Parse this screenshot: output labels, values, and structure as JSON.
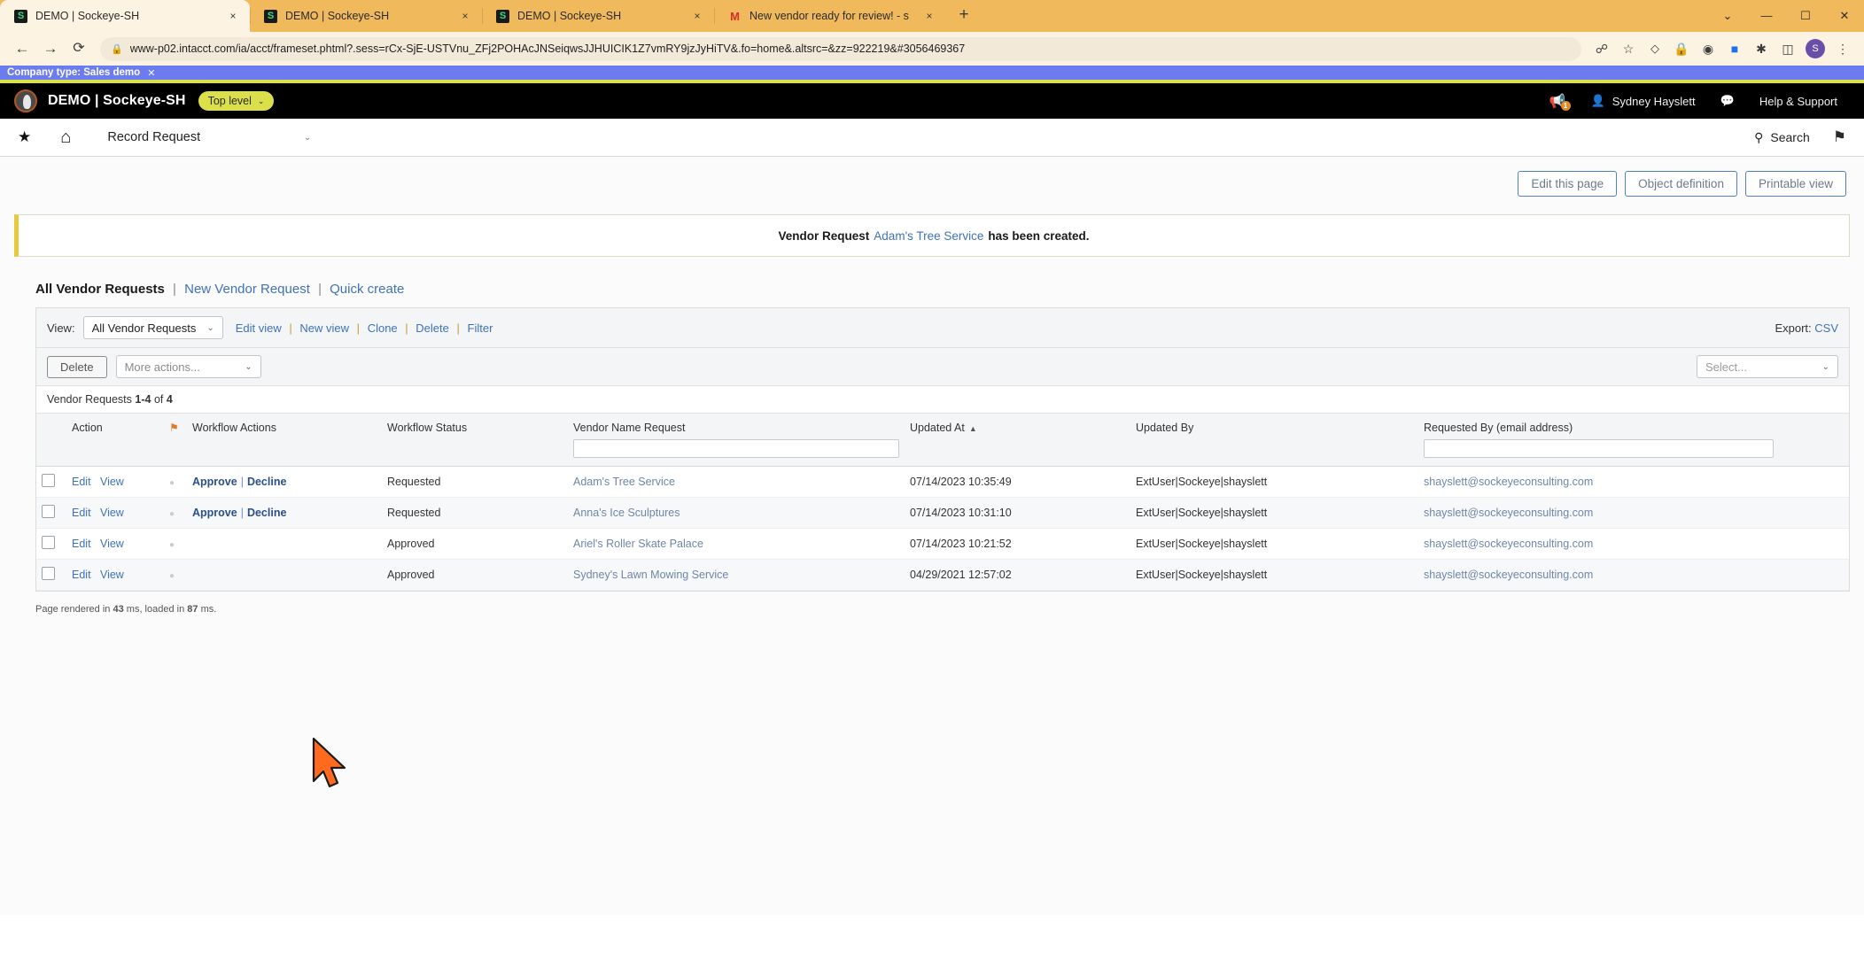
{
  "browser": {
    "tabs": [
      {
        "title": "DEMO | Sockeye-SH",
        "favicon": "S",
        "active": true
      },
      {
        "title": "DEMO | Sockeye-SH",
        "favicon": "S",
        "active": false
      },
      {
        "title": "DEMO | Sockeye-SH",
        "favicon": "S",
        "active": false
      },
      {
        "title": "New vendor ready for review! - s",
        "favicon": "M",
        "active": false
      }
    ],
    "new_tab_label": "+",
    "close_label": "×",
    "window_controls": [
      "⌄",
      "—",
      "☐",
      "✕"
    ],
    "back_label": "←",
    "forward_label": "→",
    "reload_label": "⟳",
    "lock_icon": "🔒",
    "url": "www-p02.intacct.com/ia/acct/frameset.phtml?.sess=rCx-SjE-USTVnu_ZFj2POHAcJNSeiqwsJJHUICIK1Z7vmRY9jzJyHiTV&.fo=home&.altsrc=&zz=922219&#3056469367",
    "toolbar_icons": [
      "share-icon",
      "star-icon",
      "puzzle-icon",
      "shield-icon",
      "cast-icon",
      "extension-icon",
      "window-icon",
      "account-icon",
      "menu-icon"
    ],
    "profile_initial": "S"
  },
  "demo_banner": {
    "text": "Company type: Sales demo",
    "close": "✕"
  },
  "app_header": {
    "title": "DEMO | Sockeye-SH",
    "entity_pill": "Top level",
    "chevron": "⌄",
    "user": "Sydney Hayslett",
    "help": "Help & Support",
    "megaphone_badge": "1"
  },
  "nav": {
    "star": "★",
    "home": "⌂",
    "module": "Record Request",
    "module_chevron": "⌄",
    "search": "Search",
    "search_icon": "⚲",
    "bookmark": "⚑"
  },
  "top_buttons": {
    "edit_this_page": "Edit this page",
    "object_definition": "Object definition",
    "printable_view": "Printable view"
  },
  "alert": {
    "prefix": "Vendor Request",
    "link": "Adam's Tree Service",
    "suffix": "has been created."
  },
  "list_header": {
    "title": "All Vendor Requests",
    "new_request": "New Vendor Request",
    "quick_create": "Quick create",
    "separator": "|"
  },
  "toolbar": {
    "view_label": "View:",
    "view_value": "All Vendor Requests",
    "view_chevron": "⌄",
    "links": [
      "Edit view",
      "New view",
      "Clone",
      "Delete",
      "Filter"
    ],
    "link_separator": "|",
    "export_label": "Export:",
    "export_value": "CSV"
  },
  "actions": {
    "delete": "Delete",
    "more_actions": "More actions...",
    "more_chevron": "⌄",
    "select": "Select...",
    "select_chevron": "⌄"
  },
  "count": {
    "prefix": "Vendor Requests",
    "range": "1-4",
    "of": "of",
    "total": "4"
  },
  "table": {
    "columns": [
      {
        "label": "Action",
        "filter": false
      },
      {
        "label": "",
        "icon": "flag-icon",
        "filter": false
      },
      {
        "label": "Workflow Actions",
        "filter": false
      },
      {
        "label": "Workflow Status",
        "filter": false
      },
      {
        "label": "Vendor Name Request",
        "filter": true
      },
      {
        "label": "Updated At",
        "sort": "▲",
        "filter": false
      },
      {
        "label": "Updated By",
        "filter": false
      },
      {
        "label": "Requested By (email address)",
        "filter": true
      }
    ],
    "row_actions": {
      "edit": "Edit",
      "view": "View"
    },
    "rows": [
      {
        "approve": "Approve",
        "decline": "Decline",
        "status": "Requested",
        "vendor": "Adam's Tree Service",
        "updated_at": "07/14/2023 10:35:49",
        "updated_by": "ExtUser|Sockeye|shayslett",
        "requested_by": "shayslett@sockeyeconsulting.com"
      },
      {
        "approve": "Approve",
        "decline": "Decline",
        "status": "Requested",
        "vendor": "Anna's Ice Sculptures",
        "updated_at": "07/14/2023 10:31:10",
        "updated_by": "ExtUser|Sockeye|shayslett",
        "requested_by": "shayslett@sockeyeconsulting.com"
      },
      {
        "approve": "",
        "decline": "",
        "status": "Approved",
        "vendor": "Ariel's Roller Skate Palace",
        "updated_at": "07/14/2023 10:21:52",
        "updated_by": "ExtUser|Sockeye|shayslett",
        "requested_by": "shayslett@sockeyeconsulting.com"
      },
      {
        "approve": "",
        "decline": "",
        "status": "Approved",
        "vendor": "Sydney's Lawn Mowing Service",
        "updated_at": "04/29/2021 12:57:02",
        "updated_by": "ExtUser|Sockeye|shayslett",
        "requested_by": "shayslett@sockeyeconsulting.com"
      }
    ]
  },
  "footer": {
    "p1": "Page rendered in",
    "rendered_ms": "43",
    "p2": "ms, loaded in",
    "loaded_ms": "87",
    "p3": "ms."
  },
  "colors": {
    "tabstrip": "#f0b95c",
    "toolbar": "#fdf3e2",
    "demo_banner": "#6b7cf0",
    "accent_yellow": "#dbe04a",
    "link_blue": "#3f72b8",
    "header_black": "#000000"
  }
}
